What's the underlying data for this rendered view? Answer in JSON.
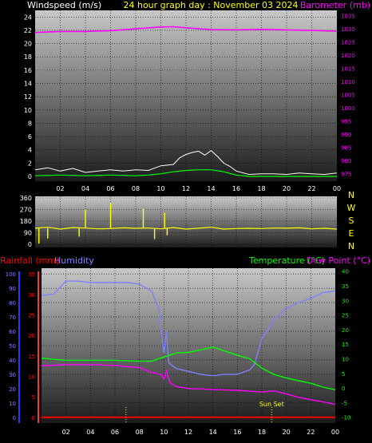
{
  "header": {
    "left_label": "Windspeed (m/s)",
    "center_label": "24 hour graph day : November 03 2024",
    "right_label": "Barometer (mb)"
  },
  "colors": {
    "background": "#000000",
    "plot_top": "#c8c8c8",
    "plot_bottom": "#1c1c1c",
    "windspeed": "#ffffff",
    "wind_avg": "#00ff00",
    "barometer": "#ff00ff",
    "direction": "#ffff00",
    "humidity": "#8080ff",
    "temperature": "#00ff00",
    "dewpoint": "#ff00ff",
    "rainfall": "#ff0000",
    "marker": "#ffff00",
    "axis_text": "#ffffff"
  },
  "x_axis": {
    "tick_labels": [
      "02",
      "04",
      "06",
      "08",
      "10",
      "12",
      "14",
      "16",
      "18",
      "20",
      "22",
      "00"
    ]
  },
  "chart_data": [
    {
      "type": "line",
      "name": "wind-barometer",
      "left_axis": {
        "label": "Windspeed (m/s)",
        "ticks": [
          0,
          2,
          4,
          6,
          8,
          10,
          12,
          14,
          16,
          18,
          20,
          22,
          24
        ],
        "range": [
          0,
          25
        ]
      },
      "right_axis": {
        "label": "Barometer (mb)",
        "ticks": [
          975,
          980,
          985,
          990,
          995,
          1000,
          1005,
          1010,
          1015,
          1020,
          1025,
          1030,
          1035
        ],
        "range": [
          974,
          1037
        ]
      },
      "series": [
        {
          "name": "Windspeed (m/s)",
          "axis": "left",
          "x": [
            0,
            1,
            2,
            3,
            4,
            5,
            6,
            7,
            8,
            9,
            10,
            11,
            11.5,
            12,
            12.5,
            13,
            13.5,
            14,
            14.5,
            15,
            15.5,
            16,
            17,
            18,
            19,
            20,
            21,
            22,
            23,
            24
          ],
          "y": [
            1.0,
            1.3,
            0.8,
            1.2,
            0.6,
            0.8,
            1.0,
            0.8,
            1.0,
            0.9,
            1.6,
            1.8,
            2.8,
            3.3,
            3.6,
            3.8,
            3.2,
            3.9,
            3.0,
            2.0,
            1.5,
            0.8,
            0.3,
            0.4,
            0.4,
            0.3,
            0.5,
            0.4,
            0.3,
            0.5
          ]
        },
        {
          "name": "Wind average",
          "axis": "left",
          "x": [
            0,
            2,
            4,
            6,
            8,
            9,
            10,
            11,
            12,
            13,
            14,
            15,
            16,
            17,
            18,
            20,
            22,
            24
          ],
          "y": [
            0.1,
            0.2,
            0.1,
            0.2,
            0.1,
            0.2,
            0.4,
            0.7,
            0.9,
            1.0,
            1.0,
            0.7,
            0.2,
            0.0,
            0.0,
            0.0,
            0.0,
            0.0
          ]
        },
        {
          "name": "Barometer (mb)",
          "axis": "right",
          "x": [
            0,
            2,
            4,
            6,
            8,
            10,
            11,
            12,
            14,
            16,
            18,
            20,
            22,
            24
          ],
          "y": [
            1028.6,
            1029.0,
            1029.0,
            1029.3,
            1030.0,
            1030.7,
            1030.8,
            1030.4,
            1029.7,
            1029.6,
            1029.8,
            1029.6,
            1029.4,
            1029.1
          ]
        }
      ]
    },
    {
      "type": "line",
      "name": "wind-direction",
      "left_axis": {
        "ticks": [
          0,
          90,
          180,
          270,
          360
        ],
        "range": [
          0,
          360
        ]
      },
      "compass": [
        "N",
        "W",
        "S",
        "E",
        "N"
      ],
      "series": [
        {
          "name": "Direction",
          "x": [
            0,
            1,
            2,
            3,
            4,
            5,
            6,
            7,
            8,
            9,
            10,
            11,
            12,
            13,
            14,
            15,
            16,
            17,
            18,
            19,
            20,
            21,
            22,
            23,
            24
          ],
          "y": [
            125,
            132,
            118,
            130,
            126,
            120,
            122,
            128,
            124,
            126,
            120,
            130,
            118,
            125,
            132,
            118,
            122,
            124,
            122,
            126,
            125,
            128,
            120,
            124,
            118
          ]
        }
      ],
      "spikes": {
        "x": [
          4.0,
          6.0,
          8.6,
          10.3
        ],
        "y": [
          270,
          320,
          275,
          245
        ]
      },
      "dips": {
        "x": [
          0.3,
          1.0,
          3.5,
          9.5,
          10.5
        ],
        "y": [
          5,
          45,
          60,
          40,
          70
        ]
      }
    },
    {
      "type": "line",
      "name": "rain-humidity-temperature",
      "left_axis_humidity": {
        "label": "Humidity",
        "ticks": [
          0,
          10,
          20,
          30,
          40,
          50,
          60,
          70,
          80,
          90,
          100
        ],
        "range": [
          -4,
          104
        ]
      },
      "left_axis_rain": {
        "label": "Rainfall (mm)",
        "ticks": [
          0,
          5,
          10,
          15,
          20,
          25,
          30,
          35
        ],
        "range": [
          -1.4,
          36.4
        ]
      },
      "right_axis": {
        "label": "Temperature (°C)",
        "label2": "Dew Point (°C)",
        "ticks": [
          -10,
          -5,
          0,
          5,
          10,
          15,
          20,
          25,
          30,
          35,
          40
        ],
        "range": [
          -12,
          41
        ]
      },
      "series": [
        {
          "name": "Humidity",
          "axis": "humidity",
          "x": [
            0,
            1,
            2,
            3,
            4,
            6,
            7,
            8,
            9,
            9.6,
            10,
            10.2,
            10.4,
            11,
            12,
            13,
            14,
            15,
            16,
            17,
            17.4,
            18,
            19,
            20,
            21,
            22,
            23,
            24
          ],
          "y": [
            85,
            86,
            95,
            95,
            94,
            94,
            94,
            93,
            88,
            75,
            45,
            60,
            38,
            34,
            32,
            30,
            29,
            30,
            30,
            33,
            37,
            55,
            68,
            76,
            80,
            83,
            87,
            88
          ]
        },
        {
          "name": "Temperature (°C)",
          "axis": "right",
          "x": [
            0,
            1,
            2,
            4,
            6,
            8,
            9,
            10,
            11,
            12,
            13,
            14,
            15,
            16,
            17,
            18,
            19,
            20,
            21,
            22,
            23,
            24
          ],
          "y": [
            10.2,
            9.8,
            9.5,
            9.5,
            9.5,
            9.2,
            9.2,
            10.6,
            12.0,
            12.2,
            13.0,
            14.0,
            12.6,
            11.2,
            10.0,
            6.8,
            4.6,
            3.4,
            2.5,
            1.6,
            0.3,
            -0.6
          ]
        },
        {
          "name": "Dew Point (°C)",
          "axis": "right",
          "x": [
            0,
            1,
            2,
            4,
            6,
            7,
            8,
            9,
            9.8,
            10,
            10.2,
            10.5,
            11,
            12,
            14,
            16,
            17,
            18,
            19,
            20,
            21,
            22,
            23,
            24
          ],
          "y": [
            7.6,
            7.8,
            8.0,
            8.0,
            7.7,
            7.3,
            7.0,
            5.3,
            4.6,
            3.0,
            5.8,
            1.8,
            0.5,
            -0.2,
            -0.5,
            -0.8,
            -1.1,
            -1.4,
            -1.0,
            -2.0,
            -3.2,
            -4.0,
            -4.8,
            -5.6
          ]
        },
        {
          "name": "Rainfall (mm)",
          "axis": "rain",
          "x": [
            0,
            24
          ],
          "y": [
            0,
            0
          ]
        }
      ],
      "markers": [
        {
          "x": 6.9
        },
        {
          "x": 18.8,
          "label": "Sun Set"
        }
      ]
    }
  ]
}
